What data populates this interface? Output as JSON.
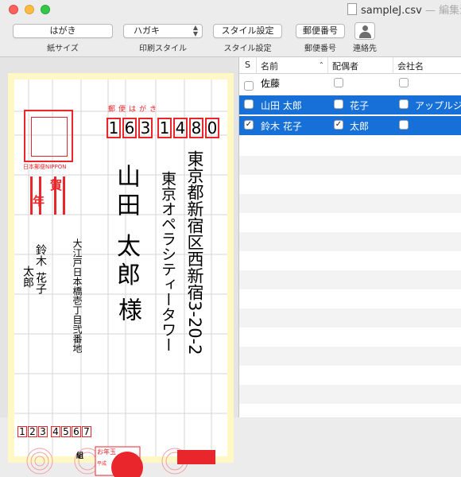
{
  "window": {
    "title": "sampleJ.csv",
    "subtitle": "— 編集済"
  },
  "toolbar": {
    "paper_value": "はがき",
    "paper_label": "紙サイズ",
    "style_value": "ハガキ",
    "style_label": "印刷スタイル",
    "style_button": "スタイル設定",
    "style_button_label": "スタイル設定",
    "zip_button": "郵便番号",
    "zip_label": "郵便番号",
    "contact_label": "連絡先"
  },
  "postcard": {
    "header": "郵便はがき",
    "zip_digits": [
      "1",
      "6",
      "3",
      "1",
      "4",
      "8",
      "0"
    ],
    "address_line1": "東京都新宿区西新宿3-20-2",
    "address_line2": "東京オペラシティータワー",
    "recipient_name": "山田 太郎",
    "honorific": "様",
    "sender_address": "大江戸日本橋壱丁目弐番地",
    "sender_name1": "鈴木",
    "sender_name2": "花子",
    "sender_name3": "太郎",
    "sender_zip_digits": [
      "1",
      "2",
      "3",
      "4",
      "5",
      "6",
      "7"
    ],
    "nenga_top": "年",
    "nenga_bottom": "賀",
    "stamp_caption": "日本郵便NIPPON",
    "lottery_label": "お年玉",
    "lottery_year": "平成",
    "group_label": "組"
  },
  "table": {
    "headers": [
      "S",
      "名前",
      "配偶者",
      "会社名"
    ],
    "rows": [
      {
        "checked": false,
        "name": "佐藤",
        "spouse_checked": false,
        "spouse": "",
        "company_checked": false,
        "company": "",
        "selected": false
      },
      {
        "checked": false,
        "name": "山田 太郎",
        "spouse_checked": false,
        "spouse": "花子",
        "company_checked": false,
        "company": "アップルジ",
        "selected": true
      },
      {
        "checked": true,
        "name": "鈴木 花子",
        "spouse_checked": true,
        "spouse": "太郎",
        "company_checked": false,
        "company": "",
        "selected": true
      }
    ]
  },
  "colors": {
    "accent": "#1670d8",
    "stamp_red": "#e8262b",
    "card_border": "#fff8c4"
  }
}
